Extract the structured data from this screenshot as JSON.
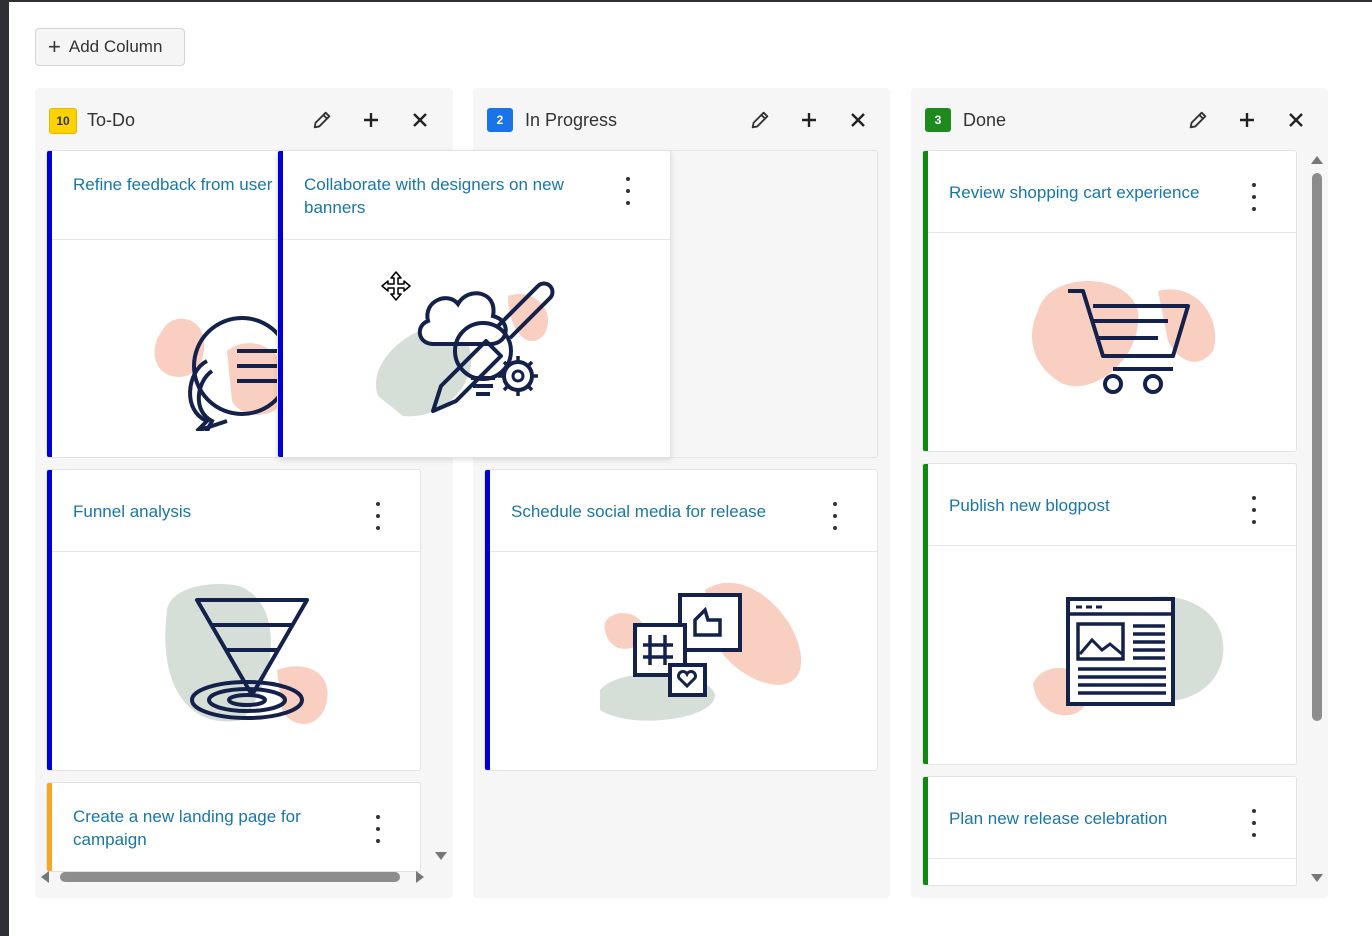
{
  "toolbar": {
    "add_column_label": "Add Column",
    "add_column_icon": "plus-icon"
  },
  "colors": {
    "todo_badge": "#fcd200",
    "todo_badge_text": "#333333",
    "progress_badge": "#1a73e8",
    "done_badge": "#1e8a1e",
    "stripe_blue": "#0000d6",
    "stripe_green": "#0d8a0d",
    "stripe_orange": "#f5a623",
    "card_title": "#1976a8",
    "accent_peach": "#f9cfc2",
    "accent_sage": "#d5dfd8",
    "icon_navy": "#14214a"
  },
  "columns": [
    {
      "title": "To-Do",
      "count": "10",
      "cards": [
        {
          "title": "Refine feedback from user interviews",
          "icon": "chat-bubbles-icon"
        },
        {
          "title": "Funnel analysis",
          "icon": "funnel-icon"
        },
        {
          "title": "Create a new landing page for campaign",
          "icon": ""
        }
      ]
    },
    {
      "title": "In Progress",
      "count": "2",
      "cards": [
        {
          "title": "Collaborate with designers on new banners",
          "icon": "creative-idea-icon"
        },
        {
          "title": "Schedule social media for release",
          "icon": "social-media-icon"
        }
      ]
    },
    {
      "title": "Done",
      "count": "3",
      "cards": [
        {
          "title": "Review shopping cart experience",
          "icon": "shopping-cart-icon"
        },
        {
          "title": "Publish new blogpost",
          "icon": "blog-post-icon"
        },
        {
          "title": "Plan new release celebration",
          "icon": ""
        }
      ]
    }
  ]
}
